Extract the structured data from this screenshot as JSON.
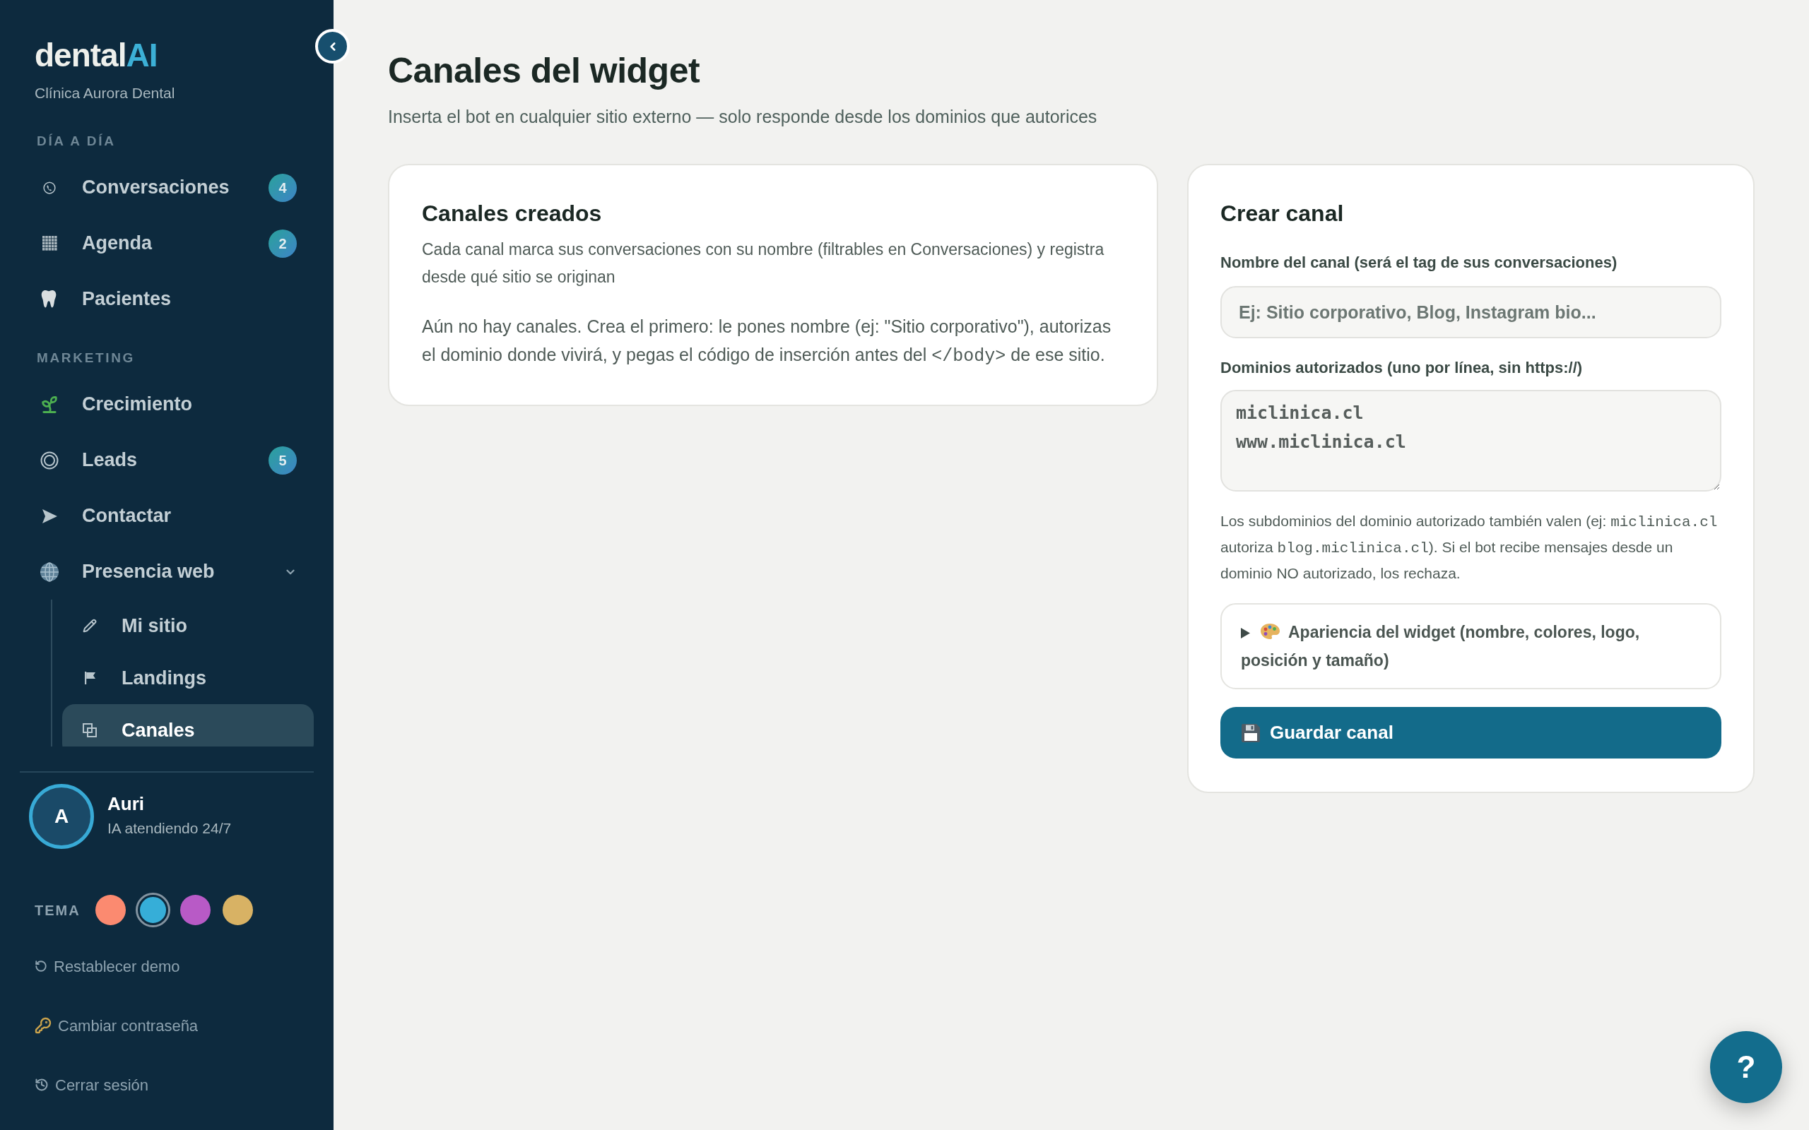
{
  "sidebar": {
    "brand": {
      "name": "dental",
      "accent": "AI"
    },
    "clinic": "Clínica Aurora Dental",
    "sections": [
      {
        "title": "DÍA A DÍA",
        "items": [
          {
            "label": "Conversaciones",
            "badge": "4",
            "selected": false
          },
          {
            "label": "Agenda",
            "badge": "2",
            "selected": false
          },
          {
            "label": "Pacientes",
            "selected": false
          }
        ]
      },
      {
        "title": "MARKETING",
        "items": [
          {
            "label": "Crecimiento",
            "selected": false
          },
          {
            "label": "Leads",
            "badge": "5",
            "selected": false
          },
          {
            "label": "Contactar",
            "selected": false
          },
          {
            "label": "Presencia web",
            "selected": false,
            "expanded": true,
            "children": [
              {
                "label": "Mi sitio",
                "selected": false
              },
              {
                "label": "Landings",
                "selected": false
              },
              {
                "label": "Canales",
                "selected": true
              }
            ]
          }
        ]
      }
    ],
    "assistant": {
      "initial": "A",
      "name": "Auri",
      "status": "IA atendiendo 24/7"
    },
    "theme": {
      "label": "TEMA",
      "swatches": [
        {
          "color": "#fb8a70",
          "selected": false
        },
        {
          "color": "#36aed8",
          "selected": true
        },
        {
          "color": "#b85ac6",
          "selected": false
        },
        {
          "color": "#d8b264",
          "selected": false
        }
      ]
    },
    "links": [
      {
        "label": "Restablecer demo"
      },
      {
        "label": "Cambiar contraseña"
      },
      {
        "label": "Cerrar sesión"
      }
    ]
  },
  "page": {
    "title": "Canales del widget",
    "subtitle": "Inserta el bot en cualquier sitio externo — solo responde desde los dominios que autorices"
  },
  "channels_card": {
    "title": "Canales creados",
    "description": "Cada canal marca sus conversaciones con su nombre (filtrables en Conversaciones) y registra desde qué sitio se originan",
    "empty_state": [
      {
        "kind": "text",
        "text": "Aún no hay canales. Crea el primero: le pones nombre (ej: \"Sitio corporativo\"), autorizas el dominio donde vivirá, y pegas el código de inserción antes del "
      },
      {
        "kind": "code",
        "text": "</body>"
      },
      {
        "kind": "text",
        "text": " de ese sitio."
      }
    ]
  },
  "create_card": {
    "title": "Crear canal",
    "fields": [
      {
        "kind": "input",
        "label": "Nombre del canal (será el tag de sus conversaciones)",
        "placeholder": "Ej: Sitio corporativo, Blog, Instagram bio..."
      },
      {
        "kind": "textarea",
        "label": "Dominios autorizados (uno por línea, sin https://)",
        "value": "miclinica.cl\nwww.miclinica.cl"
      }
    ],
    "help_text": [
      {
        "kind": "text",
        "text": "Los subdominios del dominio autorizado también valen (ej: "
      },
      {
        "kind": "code",
        "text": "miclinica.cl"
      },
      {
        "kind": "text",
        "text": " autoriza "
      },
      {
        "kind": "code",
        "text": "blog.miclinica.cl"
      },
      {
        "kind": "text",
        "text": "). Si el bot recibe mensajes desde un dominio NO autorizado, los rechaza."
      }
    ],
    "appearance": {
      "label": "Apariencia del widget (nombre, colores, logo, posición y tamaño)",
      "expanded": false
    },
    "save_button": {
      "label": "Guardar canal"
    }
  },
  "help_button": {
    "label": "?"
  }
}
